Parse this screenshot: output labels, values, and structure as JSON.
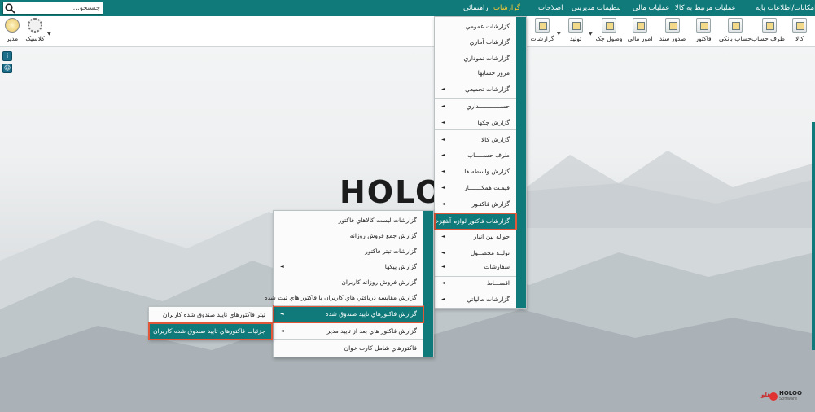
{
  "search": {
    "placeholder": "جستجو..."
  },
  "menubar": {
    "items": [
      {
        "label": "امکانات/اطلاعات پایه"
      },
      {
        "label": "عملیات مرتبط به کالا"
      },
      {
        "label": "عملیات مالی"
      },
      {
        "label": "تنظیمات مدیریتی"
      },
      {
        "label": "اصلاحات"
      },
      {
        "label": "گزارشات"
      },
      {
        "label": "راهنمائی"
      }
    ]
  },
  "toolbar": {
    "buttons": [
      {
        "label": "کالا"
      },
      {
        "label": "طرف حساب"
      },
      {
        "label": "حساب بانکی"
      },
      {
        "label": "فاکتور"
      },
      {
        "label": "صدور سند"
      },
      {
        "label": "امور مالی"
      },
      {
        "label": "وصول چک"
      },
      {
        "label": "تولید"
      },
      {
        "label": "گزارشات"
      },
      {
        "label": "کلاسیک"
      },
      {
        "label": "مدیر"
      }
    ]
  },
  "logo": {
    "text": "HOLO"
  },
  "reports_menu": {
    "items": [
      {
        "label": "گزارشات عمومي"
      },
      {
        "label": "گزارشات آماري"
      },
      {
        "label": "گزارشات نموداري"
      },
      {
        "label": "مرور حسابها"
      },
      {
        "label": "گزارشات تجميعي"
      },
      {
        "label": "حســــــــــــداري"
      },
      {
        "label": "گزارش چکها"
      },
      {
        "label": "گزارش کالا"
      },
      {
        "label": "طرف حســـــاب"
      },
      {
        "label": "گزارش واسطه ها"
      },
      {
        "label": "قيمـت همکـــــــار"
      },
      {
        "label": "گزارش فاکتـور"
      },
      {
        "label": "گزارشات فاکتور لوازم آشپزخانه"
      },
      {
        "label": "حواله بين انبار"
      },
      {
        "label": "توليـد محصــول"
      },
      {
        "label": "سفارشات"
      },
      {
        "label": "اقســـاط"
      },
      {
        "label": "گزارشات مالياتي"
      }
    ]
  },
  "kitchen_menu": {
    "items": [
      {
        "label": "گزارشات ليست کالاهاي فاکتور"
      },
      {
        "label": "گزارش جمع فروش روزانه"
      },
      {
        "label": "گزارشات تيتر فاکتور"
      },
      {
        "label": "گزارش پيکها"
      },
      {
        "label": "گزارش فروش روزانه کاربران"
      },
      {
        "label": "گزارش مقايسه دريافتي هاي  کاربران با فاکتور هاي ثبت شده"
      },
      {
        "label": "گزارش فاکتورهاي تاييد صندوق شده"
      },
      {
        "label": "گزارش فاکتور هاي بعد از تاييد مدير"
      },
      {
        "label": "فاکتورهاي شامل کارت خوان"
      }
    ]
  },
  "confirmed_menu": {
    "items": [
      {
        "label": "تيتر فاکتورهاي تاييد صندوق شده کاربران"
      },
      {
        "label": "جزئيات فاکتورهاي تاييد صندوق شده کاربران"
      }
    ]
  },
  "brand": {
    "name": "HOLOO",
    "sub": "Software",
    "fa": "هلو"
  },
  "colors": {
    "teal": "#107a7a",
    "highlight_border": "#e0573a",
    "active_menu": "#ffcc33"
  }
}
